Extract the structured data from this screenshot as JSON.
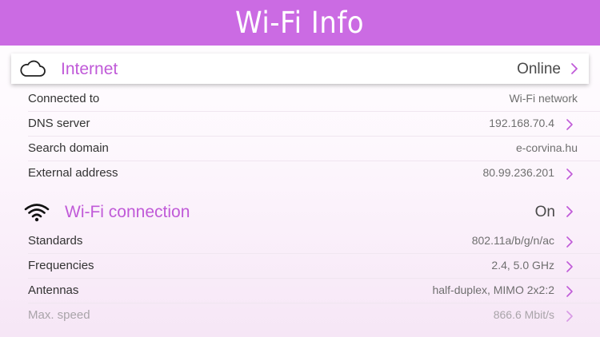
{
  "header": {
    "title": "Wi-Fi Info"
  },
  "internet": {
    "label": "Internet",
    "status": "Online",
    "icon": "cloud-icon",
    "rows": [
      {
        "label": "Connected to",
        "value": "Wi-Fi network",
        "chevron": false
      },
      {
        "label": "DNS server",
        "value": "192.168.70.4",
        "chevron": true
      },
      {
        "label": "Search domain",
        "value": "e-corvina.hu",
        "chevron": false
      },
      {
        "label": "External address",
        "value": "80.99.236.201",
        "chevron": true
      }
    ]
  },
  "wifi": {
    "label": "Wi-Fi connection",
    "status": "On",
    "icon": "wifi-icon",
    "rows": [
      {
        "label": "Standards",
        "value": "802.11a/b/g/n/ac",
        "chevron": true
      },
      {
        "label": "Frequencies",
        "value": "2.4, 5.0 GHz",
        "chevron": true
      },
      {
        "label": "Antennas",
        "value": "half-duplex, MIMO 2x2:2",
        "chevron": true
      },
      {
        "label": "Max. speed",
        "value": "866.6 Mbit/s",
        "chevron": true
      }
    ]
  },
  "colors": {
    "header": "#cb6be3",
    "accent": "#c05ad8",
    "chevron": "#c05ad8"
  }
}
